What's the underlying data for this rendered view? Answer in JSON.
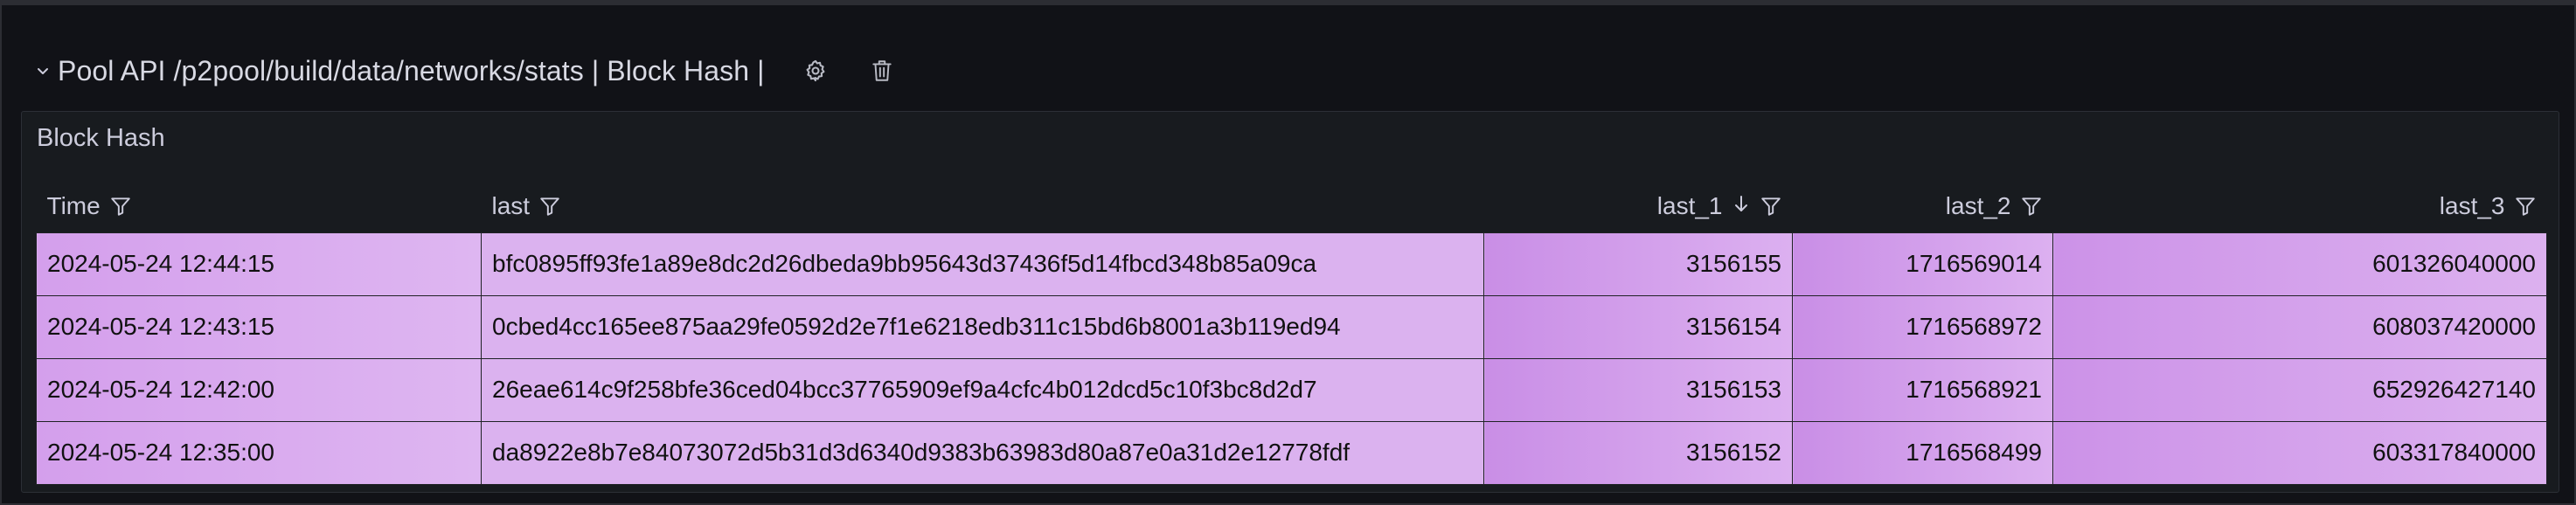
{
  "row": {
    "title": "Pool API /p2pool/build/data/networks/stats | Block Hash |"
  },
  "icons": {
    "collapse": "chevron-down-icon",
    "settings": "gear-icon",
    "delete": "trash-icon",
    "filter": "filter-icon",
    "sort": "arrow-down-icon"
  },
  "panel": {
    "title": "Block Hash"
  },
  "table": {
    "columns": [
      "Time",
      "last",
      "last_1",
      "last_2",
      "last_3"
    ],
    "sorted_column": "last_1",
    "sort_direction": "descending",
    "rows": [
      {
        "time": "2024-05-24 12:44:15",
        "last": "bfc0895ff93fe1a89e8dc2d26dbeda9bb95643d37436f5d14fbcd348b85a09ca",
        "last_1": "3156155",
        "last_2": "1716569014",
        "last_3": "601326040000"
      },
      {
        "time": "2024-05-24 12:43:15",
        "last": "0cbed4cc165ee875aa29fe0592d2e7f1e6218edb311c15bd6b8001a3b119ed94",
        "last_1": "3156154",
        "last_2": "1716568972",
        "last_3": "608037420000"
      },
      {
        "time": "2024-05-24 12:42:00",
        "last": "26eae614c9f258bfe36ced04bcc37765909ef9a4cfc4b012dcd5c10f3bc8d2d7",
        "last_1": "3156153",
        "last_2": "1716568921",
        "last_3": "652926427140"
      },
      {
        "time": "2024-05-24 12:35:00",
        "last": "da8922e8b7e84073072d5b31d3d6340d9383b63983d80a87e0a31d2e12778fdf",
        "last_1": "3156152",
        "last_2": "1716568499",
        "last_3": "603317840000"
      }
    ]
  },
  "colors": {
    "background": "#111217",
    "panel": "#181b1f",
    "cell_light": "#dbb2ef",
    "cell_dark": "#c98ee6"
  }
}
